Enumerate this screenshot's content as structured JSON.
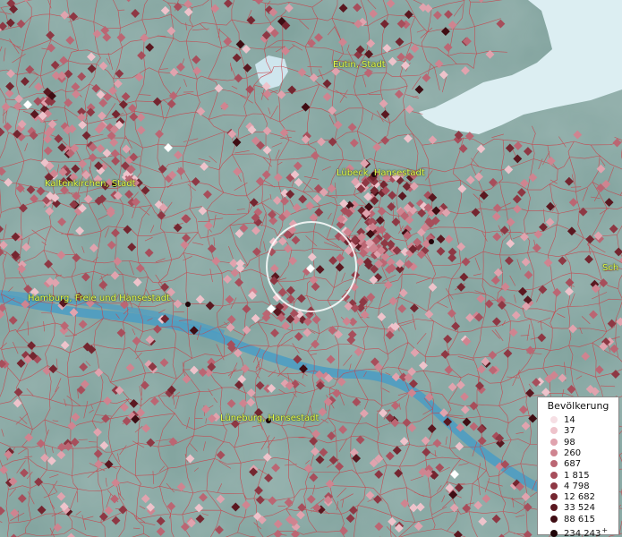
{
  "map": {
    "cities": [
      {
        "name": "Eutin, Stadt"
      },
      {
        "name": "Lübeck, Hansestadt"
      },
      {
        "name": "Kaltenkirchen, Stadt"
      },
      {
        "name": "Hamburg, Freie und Hansestadt"
      },
      {
        "name": "Lüneburg, Hansestadt"
      },
      {
        "name": "Sch"
      }
    ]
  },
  "legend": {
    "title": "Bevölkerung",
    "items": [
      {
        "label": "14",
        "color": "#f6dfe4"
      },
      {
        "label": "37",
        "color": "#eec3cb"
      },
      {
        "label": "98",
        "color": "#e0a3ae"
      },
      {
        "label": "260",
        "color": "#cf8490"
      },
      {
        "label": "687",
        "color": "#bb6673"
      },
      {
        "label": "1 815",
        "color": "#a74e5b"
      },
      {
        "label": "4 798",
        "color": "#8e3844"
      },
      {
        "label": "12 682",
        "color": "#742630"
      },
      {
        "label": "33 524",
        "color": "#5a1820"
      },
      {
        "label": "88 615",
        "color": "#3f0d13"
      },
      {
        "label": "234 243",
        "color": "#1f0508",
        "plus": "+"
      }
    ]
  }
}
